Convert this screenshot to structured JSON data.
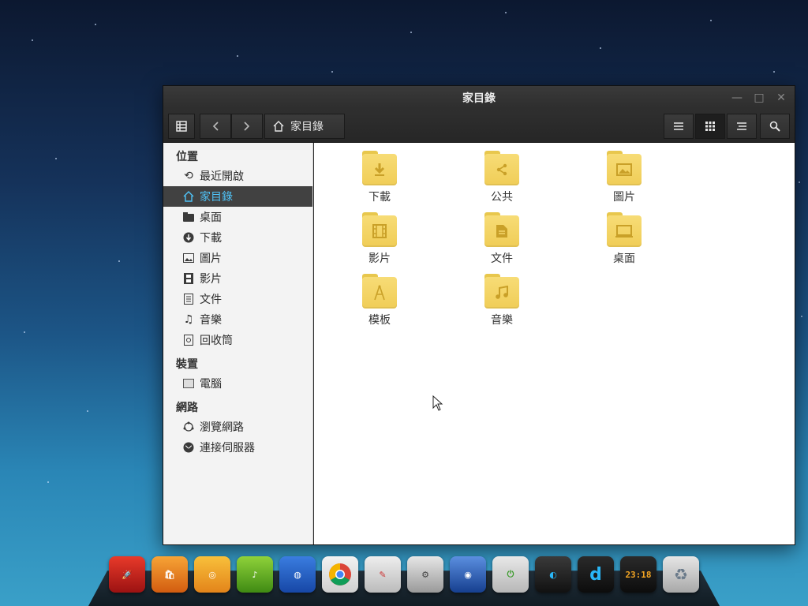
{
  "window": {
    "title": "家目錄",
    "breadcrumb": "家目錄",
    "controls": [
      "minimize-icon",
      "maximize-icon",
      "close-icon"
    ]
  },
  "sidebar": {
    "sections": [
      {
        "title": "位置",
        "items": [
          {
            "label": "最近開啟",
            "icon": "history-icon"
          },
          {
            "label": "家目錄",
            "icon": "home-icon",
            "active": true
          },
          {
            "label": "桌面",
            "icon": "folder-icon"
          },
          {
            "label": "下載",
            "icon": "download-icon"
          },
          {
            "label": "圖片",
            "icon": "image-icon"
          },
          {
            "label": "影片",
            "icon": "film-icon"
          },
          {
            "label": "文件",
            "icon": "document-icon"
          },
          {
            "label": "音樂",
            "icon": "music-icon"
          },
          {
            "label": "回收筒",
            "icon": "trash-icon"
          }
        ]
      },
      {
        "title": "裝置",
        "items": [
          {
            "label": "電腦",
            "icon": "computer-icon"
          }
        ]
      },
      {
        "title": "網路",
        "items": [
          {
            "label": "瀏覽網路",
            "icon": "network-icon"
          },
          {
            "label": "連接伺服器",
            "icon": "server-icon"
          }
        ]
      }
    ]
  },
  "files": [
    {
      "label": "下載",
      "icon": "download-folder-icon"
    },
    {
      "label": "公共",
      "icon": "share-folder-icon"
    },
    {
      "label": "圖片",
      "icon": "pictures-folder-icon"
    },
    {
      "label": "影片",
      "icon": "videos-folder-icon"
    },
    {
      "label": "文件",
      "icon": "documents-folder-icon"
    },
    {
      "label": "桌面",
      "icon": "desktop-folder-icon"
    },
    {
      "label": "模板",
      "icon": "templates-folder-icon"
    },
    {
      "label": "音樂",
      "icon": "music-folder-icon"
    }
  ],
  "dock": {
    "clock_text": "23:18",
    "apps": [
      "rocket-launcher-icon",
      "store-icon",
      "music-player-icon",
      "audio-player-icon",
      "browser-icon",
      "chrome-icon",
      "editor-icon",
      "settings-icon",
      "globe-icon",
      "power-icon",
      "media-icon",
      "d-app-icon",
      "clock-icon",
      "recycle-icon"
    ]
  },
  "colors": {
    "active_text": "#4fc3f7",
    "folder": "#f2d264",
    "folder_glyph": "#d8b13a"
  }
}
